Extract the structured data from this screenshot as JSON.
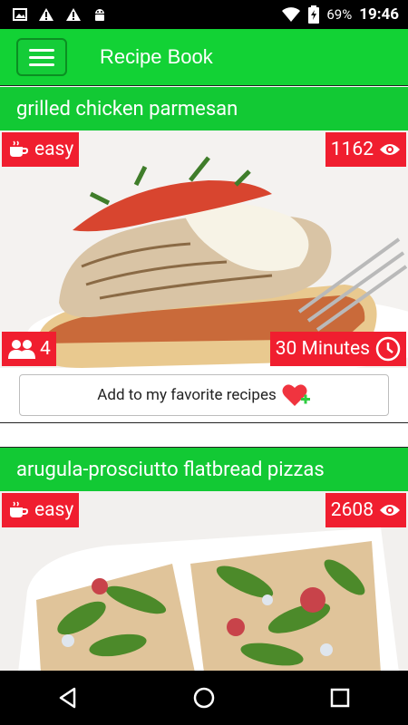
{
  "status_bar": {
    "battery": "69%",
    "time": "19:46",
    "icons": [
      "image-icon",
      "warning-icon",
      "warning-icon",
      "android-icon",
      "wifi-icon",
      "battery-icon"
    ]
  },
  "app_bar": {
    "title": "Recipe Book"
  },
  "recipes": [
    {
      "title": "grilled chicken parmesan",
      "difficulty": "easy",
      "views": "1162",
      "servings": "4",
      "time": "30 Minutes",
      "favorite_label": "Add to my favorite recipes"
    },
    {
      "title": "arugula-prosciutto flatbread pizzas",
      "difficulty": "easy",
      "views": "2608"
    }
  ],
  "colors": {
    "app_bar": "#12d235",
    "header": "#12c934",
    "badge": "#f01e2f"
  }
}
